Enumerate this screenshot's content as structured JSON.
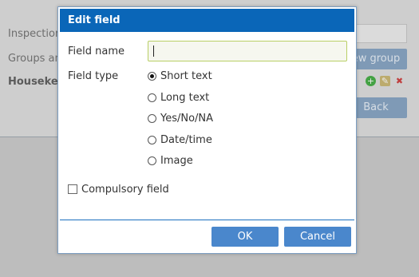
{
  "background": {
    "label_inspection": "Inspection",
    "label_groups": "Groups an",
    "label_housekeeping": "Housekee",
    "btn_new_group": "ew group",
    "btn_back": "Back",
    "icons": [
      "add-icon",
      "edit-icon",
      "delete-icon"
    ]
  },
  "dialog": {
    "title": "Edit field",
    "field_name_label": "Field name",
    "field_name_value": "",
    "field_type_label": "Field type",
    "field_types": [
      {
        "label": "Short text",
        "selected": true
      },
      {
        "label": "Long text",
        "selected": false
      },
      {
        "label": "Yes/No/NA",
        "selected": false
      },
      {
        "label": "Date/time",
        "selected": false
      },
      {
        "label": "Image",
        "selected": false
      }
    ],
    "compulsory_label": "Compulsory field",
    "compulsory_checked": false,
    "ok_label": "OK",
    "cancel_label": "Cancel"
  },
  "colors": {
    "header": "#0a66b8",
    "button": "#4a87cc",
    "input_border": "#b9cf66"
  }
}
